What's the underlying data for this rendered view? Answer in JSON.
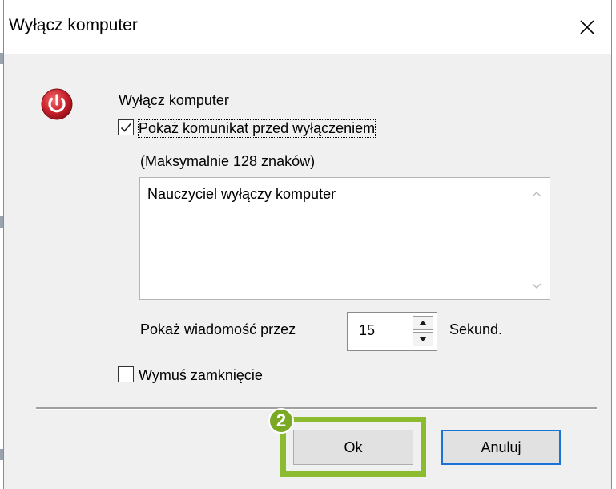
{
  "window": {
    "title": "Wyłącz komputer",
    "close_icon": "close-icon"
  },
  "content": {
    "heading": "Wyłącz komputer",
    "power_icon": "power-icon",
    "show_message_checkbox": {
      "label": "Pokaż komunikat przed wyłączeniem",
      "checked": true
    },
    "max_chars_note": "(Maksymalnie 128 znaków)",
    "message_text": "Nauczyciel wyłączy komputer",
    "duration": {
      "label": "Pokaż wiadomość przez",
      "value": "15",
      "unit": "Sekund."
    },
    "force_close_checkbox": {
      "label": "Wymuś zamknięcie",
      "checked": false
    }
  },
  "buttons": {
    "ok_label": "Ok",
    "cancel_label": "Anuluj"
  },
  "annotation": {
    "step_number": "2",
    "highlight_color": "#8dbb2f"
  },
  "colors": {
    "accent": "#1a73d9",
    "power_red": "#c8202b"
  }
}
